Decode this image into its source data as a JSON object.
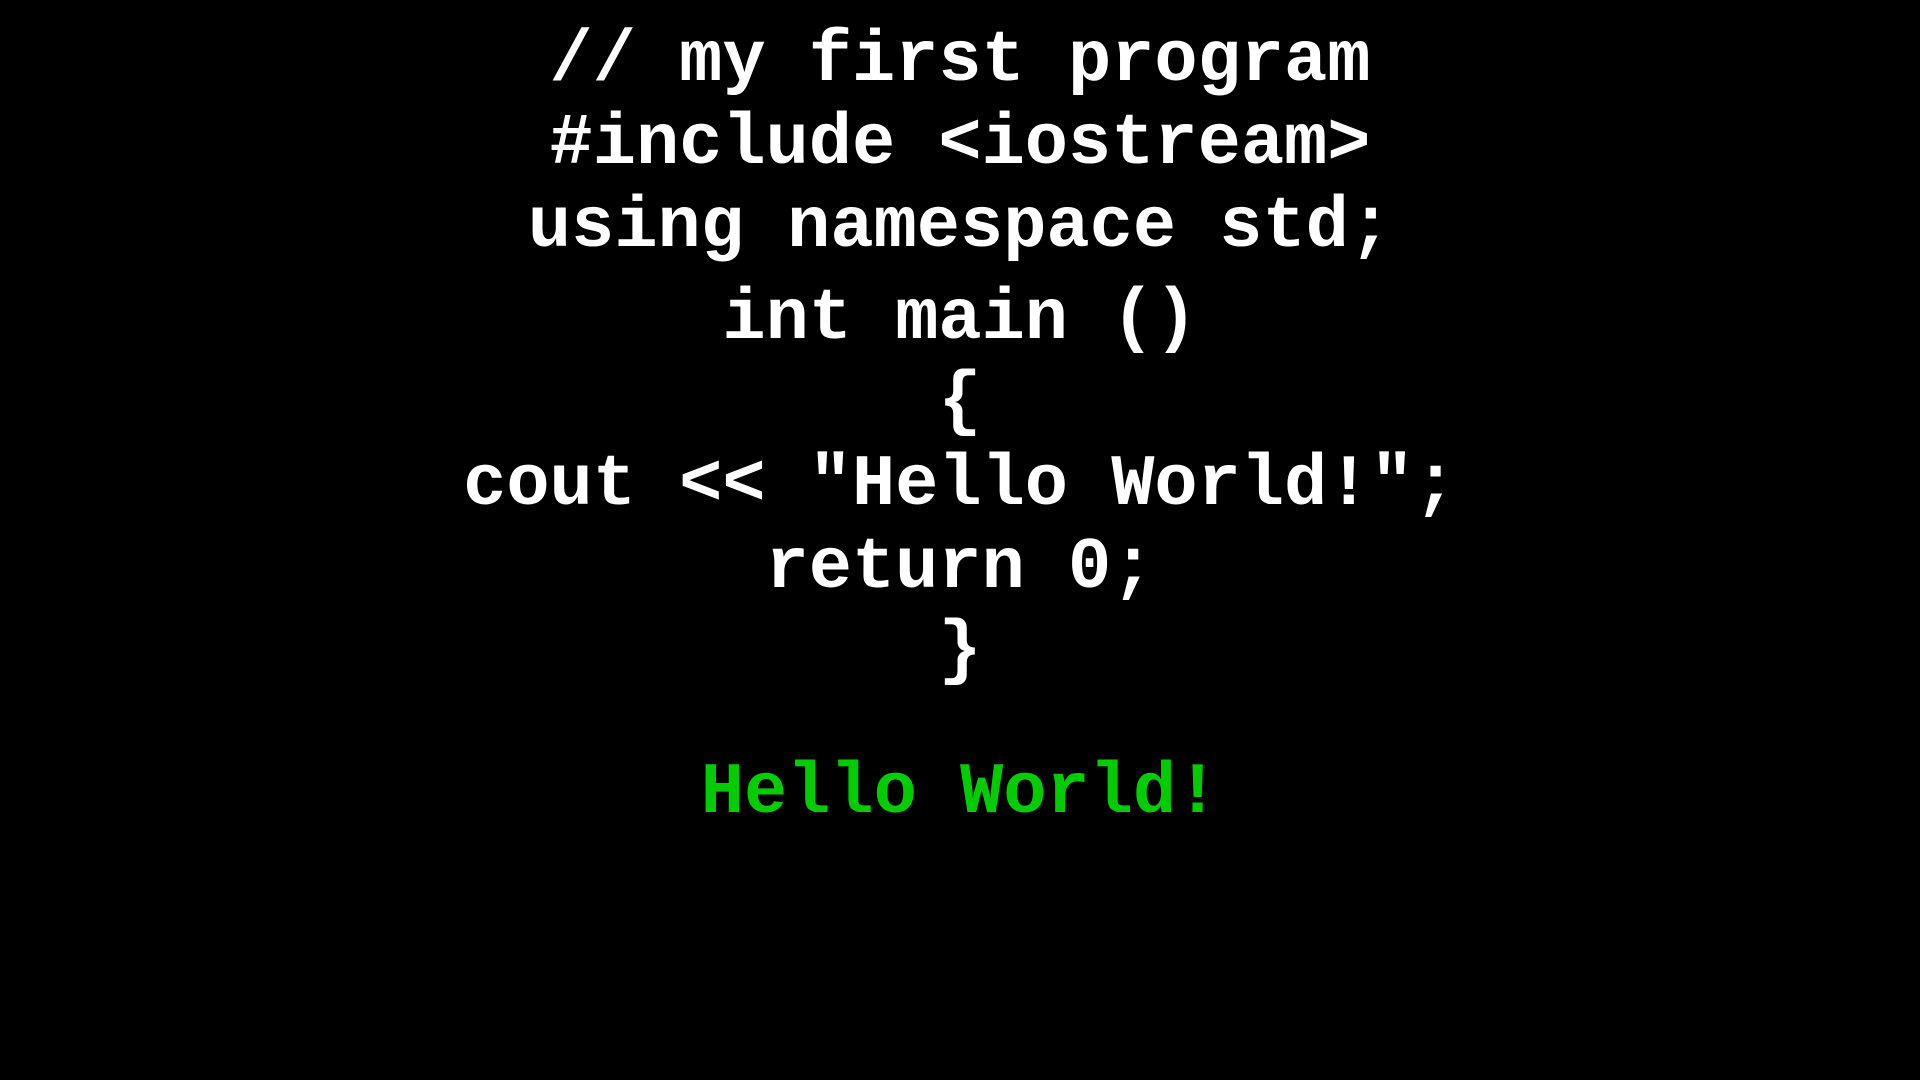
{
  "code": {
    "line1": "// my first program",
    "line2": "#include <iostream>",
    "line3": "using namespace std;",
    "line4": "int main ()",
    "line5": "{",
    "line6": "cout << \"Hello World!\";",
    "line7": "return 0;",
    "line8": "}",
    "output": "Hello World!"
  }
}
